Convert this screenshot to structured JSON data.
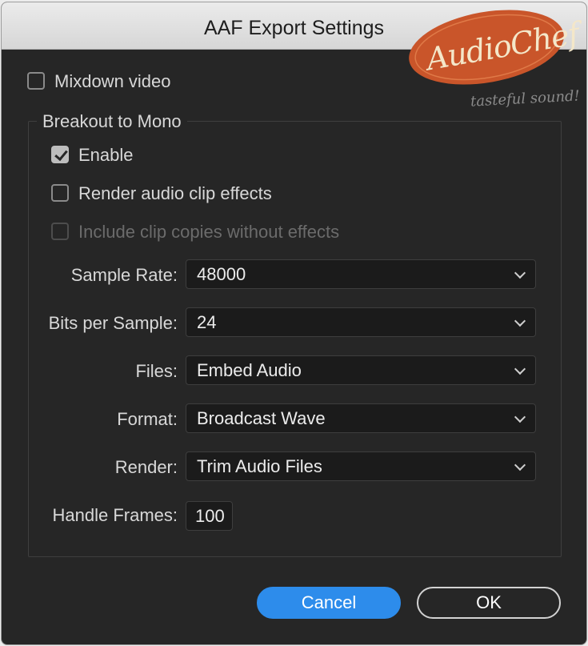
{
  "window": {
    "title": "AAF Export Settings"
  },
  "logo": {
    "text": "AudioChef",
    "tagline": "tasteful sound!",
    "colors": {
      "oval": "#c9552a",
      "text": "#f4e7c9"
    }
  },
  "mixdown": {
    "label": "Mixdown video",
    "checked": false
  },
  "breakout": {
    "legend": "Breakout to Mono",
    "enable": {
      "label": "Enable",
      "checked": true
    },
    "render_effects": {
      "label": "Render audio clip effects",
      "checked": false
    },
    "include_copies": {
      "label": "Include clip copies without effects",
      "checked": false,
      "disabled": true
    }
  },
  "fields": {
    "sample_rate": {
      "label": "Sample Rate:",
      "value": "48000"
    },
    "bits_per_sample": {
      "label": "Bits per Sample:",
      "value": "24"
    },
    "files": {
      "label": "Files:",
      "value": "Embed Audio"
    },
    "format": {
      "label": "Format:",
      "value": "Broadcast Wave"
    },
    "render": {
      "label": "Render:",
      "value": "Trim Audio Files"
    },
    "handle_frames": {
      "label": "Handle Frames:",
      "value": "100"
    }
  },
  "buttons": {
    "cancel": "Cancel",
    "ok": "OK"
  },
  "colors": {
    "accent": "#2d8ceb",
    "panel": "#262626"
  }
}
